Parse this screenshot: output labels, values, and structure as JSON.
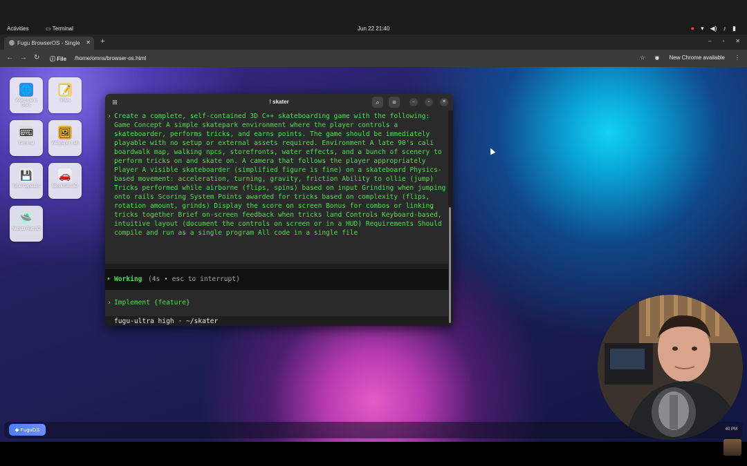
{
  "system_bar": {
    "activities": "Activities",
    "app_name": "Terminal",
    "clock": "Jun 22  21:40"
  },
  "browser": {
    "tab_title": "Fugu BrowserOS - Single",
    "new_tab": "+",
    "url_scheme": "File",
    "url_path": "/home/omns/browser-os.html",
    "update_notice": "New Chrome available"
  },
  "desktop": {
    "icons": [
      {
        "label": "Welcome to Docs",
        "glyph": "🌐",
        "icon": "globe-icon"
      },
      {
        "label": "Notes",
        "glyph": "📝",
        "icon": "notes-icon"
      },
      {
        "label": "Terminal",
        "glyph": "⌨",
        "icon": "terminal-icon"
      },
      {
        "label": "Wallpaper Lab",
        "glyph": "🖼",
        "icon": "wallpaper-icon"
      },
      {
        "label": "Time Capsules",
        "glyph": "💾",
        "icon": "floppy-disk-icon"
      },
      {
        "label": "BlockAuto 3D",
        "glyph": "🚗",
        "icon": "car-icon"
      },
      {
        "label": "Nebula Run 3D",
        "glyph": "🛸",
        "icon": "ufo-icon"
      }
    ]
  },
  "terminal": {
    "title": "skater",
    "prompt_text": "Create a complete, self-contained 3D C++ skateboarding game with the following: Game Concept A simple skatepark environment where the player controls a skateboarder, performs tricks, and earns points. The game should be immediately playable with no setup or external assets required. Environment A late 90's cali boardwalk map, walking npcs, storefronts, water effects, and a bunch of scenery to perform tricks on and skate on. A camera that follows the player appropriately Player A visible skateboarder (simplified figure is fine) on a skateboard Physics-based movement: acceleration, turning, gravity, friction Ability to ollie (jump) Tricks performed while airborne (flips, spins) based on input Grinding when jumping onto rails Scoring System Points awarded for tricks based on complexity (flips, rotation amount, grinds) Display the score on screen Bonus for combos or linking tricks together Brief on-screen feedback when tricks land Controls Keyboard-based, intuitive layout (document the controls on screen or in a HUD) Requirements Should compile and run as a single program All code in a single file",
    "working_label": "Working",
    "working_meta": "(4s • esc to interrupt)",
    "input_placeholder": "Implement {feature}",
    "status_line": "fugu-ultra high · ~/skater"
  },
  "dock": {
    "start_label": "◆ FuguOS",
    "time": "40 PM"
  }
}
